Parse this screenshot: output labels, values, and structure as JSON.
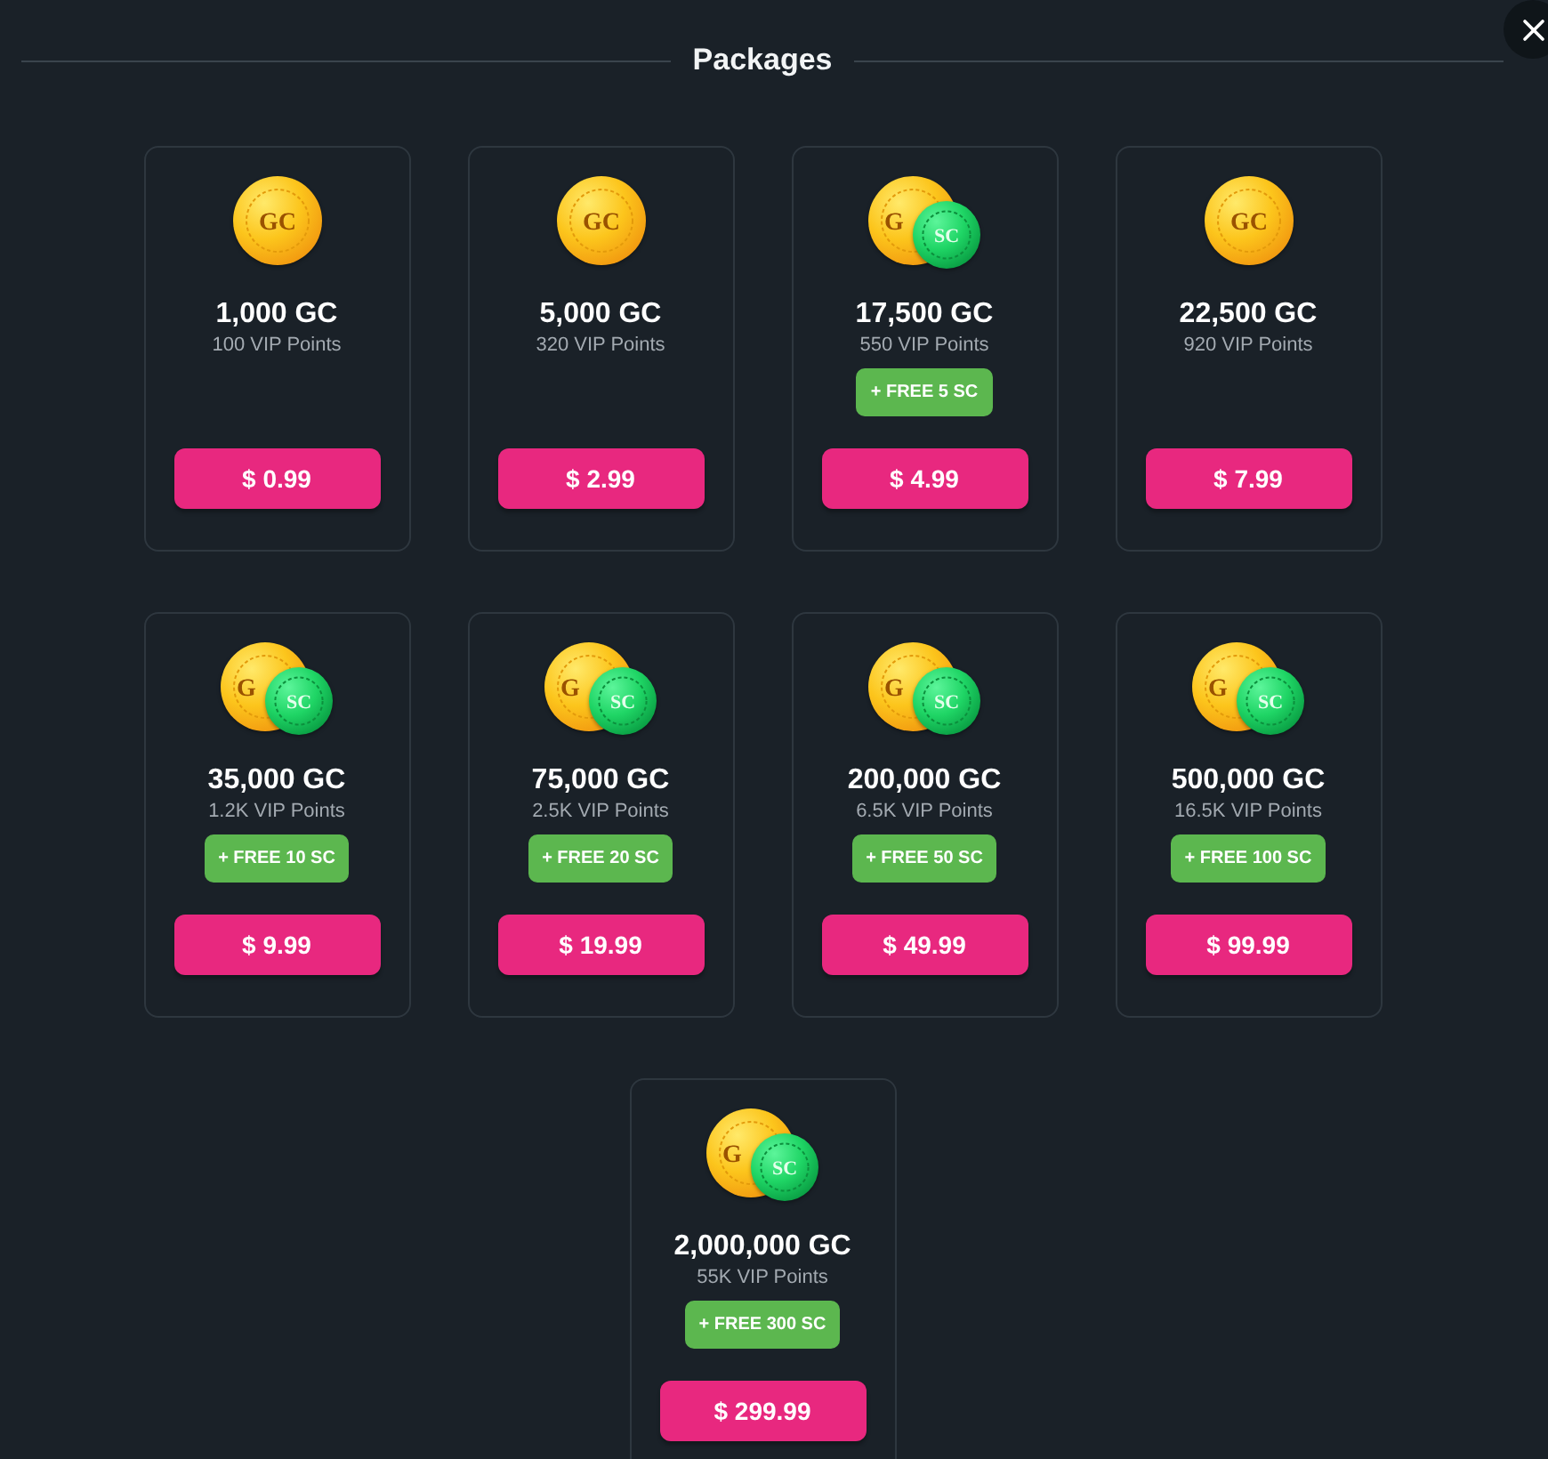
{
  "header": {
    "title": "Packages"
  },
  "packages": [
    {
      "coins": [
        {
          "kind": "gold",
          "label": "GC"
        }
      ],
      "amount": "1,000 GC",
      "vip_points": "100 VIP Points",
      "price": "$ 0.99"
    },
    {
      "coins": [
        {
          "kind": "gold",
          "label": "GC"
        }
      ],
      "amount": "5,000 GC",
      "vip_points": "320 VIP Points",
      "price": "$ 2.99"
    },
    {
      "coins": [
        {
          "kind": "gold",
          "label": "G"
        },
        {
          "kind": "sweeps",
          "label": "SC"
        }
      ],
      "amount": "17,500 GC",
      "vip_points": "550 VIP Points",
      "bonus": "+ FREE 5 SC",
      "price": "$ 4.99"
    },
    {
      "coins": [
        {
          "kind": "gold",
          "label": "GC"
        }
      ],
      "amount": "22,500 GC",
      "vip_points": "920 VIP Points",
      "price": "$ 7.99"
    },
    {
      "coins": [
        {
          "kind": "gold",
          "label": "G"
        },
        {
          "kind": "sweeps",
          "label": "SC"
        }
      ],
      "amount": "35,000 GC",
      "vip_points": "1.2K VIP Points",
      "bonus": "+ FREE 10 SC",
      "price": "$ 9.99"
    },
    {
      "coins": [
        {
          "kind": "gold",
          "label": "G"
        },
        {
          "kind": "sweeps",
          "label": "SC"
        }
      ],
      "amount": "75,000 GC",
      "vip_points": "2.5K VIP Points",
      "bonus": "+ FREE 20 SC",
      "price": "$ 19.99"
    },
    {
      "coins": [
        {
          "kind": "gold",
          "label": "G"
        },
        {
          "kind": "sweeps",
          "label": "SC"
        }
      ],
      "amount": "200,000 GC",
      "vip_points": "6.5K VIP Points",
      "bonus": "+ FREE 50 SC",
      "price": "$ 49.99"
    },
    {
      "coins": [
        {
          "kind": "gold",
          "label": "G"
        },
        {
          "kind": "sweeps",
          "label": "SC"
        }
      ],
      "amount": "500,000 GC",
      "vip_points": "16.5K VIP Points",
      "bonus": "+ FREE 100 SC",
      "price": "$ 99.99"
    },
    {
      "coins": [
        {
          "kind": "gold",
          "label": "G"
        },
        {
          "kind": "sweeps",
          "label": "SC"
        }
      ],
      "amount": "2,000,000 GC",
      "vip_points": "55K VIP Points",
      "bonus": "+ FREE 300 SC",
      "price": "$ 299.99"
    }
  ]
}
